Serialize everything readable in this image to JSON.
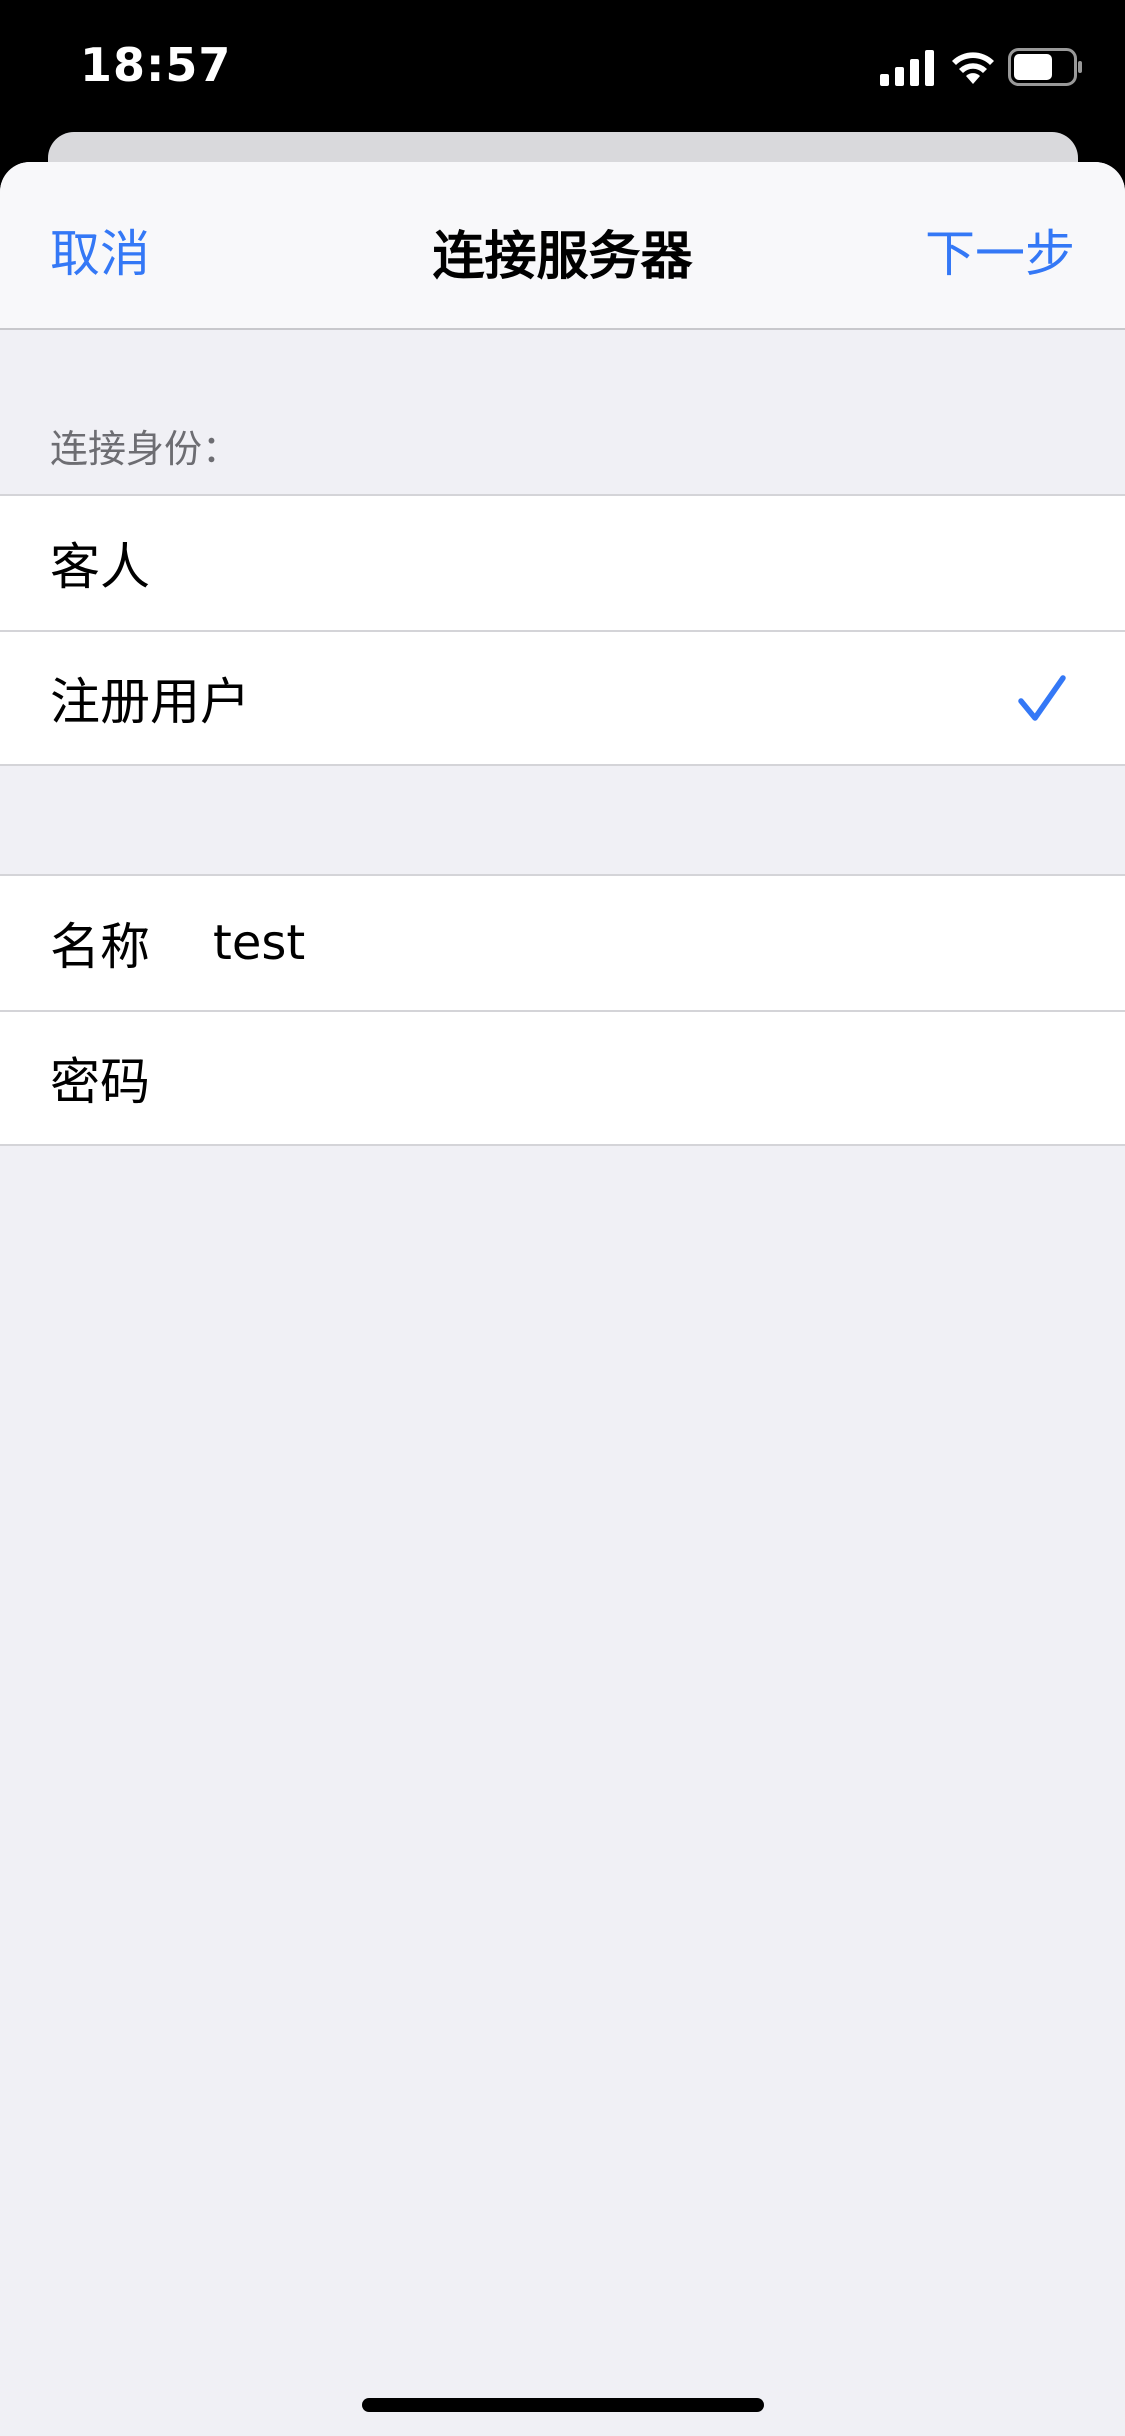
{
  "status_bar": {
    "time": "18:57",
    "icons": [
      "signal-icon",
      "wifi-icon",
      "battery-icon"
    ]
  },
  "nav": {
    "cancel_label": "取消",
    "title": "连接服务器",
    "next_label": "下一步"
  },
  "identity": {
    "header": "连接身份：",
    "options": [
      {
        "label": "客人",
        "selected": false
      },
      {
        "label": "注册用户",
        "selected": true
      }
    ]
  },
  "credentials": {
    "name_label": "名称",
    "name_value": "test",
    "password_label": "密码",
    "password_value": ""
  },
  "colors": {
    "accent": "#3478f6",
    "background": "#f0f0f5",
    "secondary_text": "#6d6d72"
  }
}
